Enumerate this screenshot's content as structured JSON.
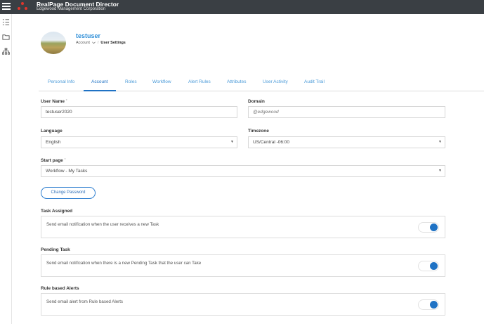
{
  "header": {
    "app_title": "RealPage Document Director",
    "company": "Edgewood Management Corporation",
    "logo_color": "#e0362c",
    "bar_color": "#3a3f44"
  },
  "sidebar": {
    "icons": [
      "list-icon",
      "folder-icon",
      "org-chart-icon"
    ]
  },
  "profile": {
    "username": "testuser",
    "breadcrumb_parent": "Account",
    "breadcrumb_separator": "/",
    "breadcrumb_current": "User Settings"
  },
  "tabs": [
    {
      "label": "Personal Info",
      "active": false
    },
    {
      "label": "Account",
      "active": true
    },
    {
      "label": "Roles",
      "active": false
    },
    {
      "label": "Workflow",
      "active": false
    },
    {
      "label": "Alert Rules",
      "active": false
    },
    {
      "label": "Attributes",
      "active": false
    },
    {
      "label": "User Activity",
      "active": false
    },
    {
      "label": "Audit Trail",
      "active": false
    }
  ],
  "form": {
    "username_label": "User Name",
    "username_value": "testuser2020",
    "domain_label": "Domain",
    "domain_placeholder": "@edgewood",
    "language_label": "Language",
    "language_value": "English",
    "timezone_label": "Timezone",
    "timezone_value": "US/Central -06:00",
    "startpage_label": "Start page",
    "startpage_value": "Workflow - My Tasks",
    "required_mark": "*",
    "change_password_label": "Change Password"
  },
  "notifications": [
    {
      "title": "Task Assigned",
      "text": "Send email notification when the user receives a new Task",
      "enabled": true
    },
    {
      "title": "Pending Task",
      "text": "Send email notification when there is a new Pending Task that the user can Take",
      "enabled": true
    },
    {
      "title": "Rule based Alerts",
      "text": "Send email alert from Rule based Alerts",
      "enabled": true
    }
  ],
  "colors": {
    "accent": "#1f72c4",
    "link": "#4a9ad8"
  }
}
